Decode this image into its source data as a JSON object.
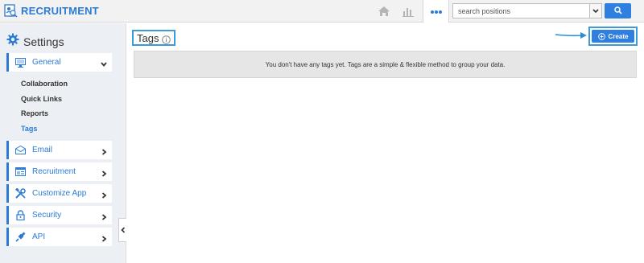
{
  "app": {
    "title": "RECRUITMENT"
  },
  "search": {
    "placeholder": "search positions"
  },
  "sidebar": {
    "heading": "Settings",
    "items": [
      {
        "label": "General",
        "icon": "monitor-icon",
        "expanded": true
      },
      {
        "label": "Email",
        "icon": "envelope-icon"
      },
      {
        "label": "Recruitment",
        "icon": "id-card-icon"
      },
      {
        "label": "Customize App",
        "icon": "tools-icon"
      },
      {
        "label": "Security",
        "icon": "lock-icon"
      },
      {
        "label": "API",
        "icon": "plug-icon"
      }
    ],
    "subitems": [
      {
        "label": "Collaboration",
        "active": false
      },
      {
        "label": "Quick Links",
        "active": false
      },
      {
        "label": "Reports",
        "active": false
      },
      {
        "label": "Tags",
        "active": true
      }
    ]
  },
  "main": {
    "title": "Tags",
    "create_label": "Create",
    "empty_message": "You don't have any tags yet. Tags are a simple & flexible method to group your data."
  },
  "colors": {
    "accent": "#2b7bd6",
    "button": "#2f7fe0",
    "highlight": "#3a9bd8",
    "sidebar_bg": "#eceff3"
  }
}
